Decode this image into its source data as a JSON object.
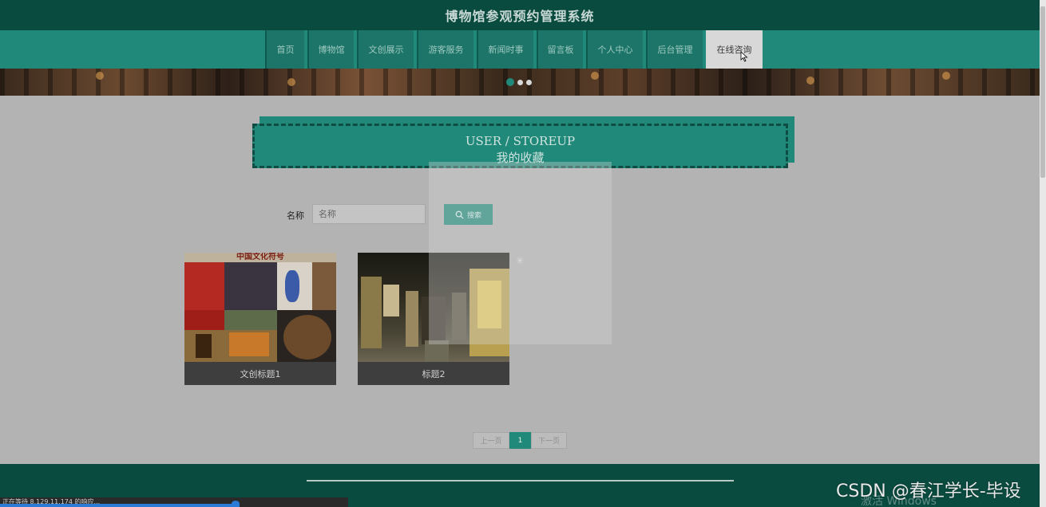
{
  "header": {
    "title": "博物馆参观预约管理系统"
  },
  "nav": {
    "items": [
      {
        "label": "首页",
        "width": 49
      },
      {
        "label": "博物馆",
        "width": 58
      },
      {
        "label": "文创展示",
        "width": 71
      },
      {
        "label": "游客服务",
        "width": 71
      },
      {
        "label": "新闻时事",
        "width": 71
      },
      {
        "label": "留言板",
        "width": 58
      },
      {
        "label": "个人中心",
        "width": 71
      },
      {
        "label": "后台管理",
        "width": 71
      },
      {
        "label": "在线咨询",
        "width": 71,
        "active": true
      }
    ]
  },
  "banner": {
    "active_slide": 1,
    "slide_count": 3
  },
  "section": {
    "en": "USER / STOREUP",
    "cn": "我的收藏"
  },
  "search": {
    "label": "名称",
    "placeholder": "名称",
    "button_label": "搜索"
  },
  "cards": [
    {
      "image_text": "中国文化符号",
      "title": "文创标题1"
    },
    {
      "title": "标题2"
    }
  ],
  "pagination": {
    "prev": "上一页",
    "current": "1",
    "next": "下一页"
  },
  "status": {
    "text": "正在等待 8.129.11.174 的响应..."
  },
  "watermark": {
    "text": "CSDN @春江学长-毕设",
    "sub": "激活 Windows"
  },
  "colors": {
    "primary": "#21897a",
    "header": "#0a4b40",
    "overlay": "#b3b3b3"
  }
}
